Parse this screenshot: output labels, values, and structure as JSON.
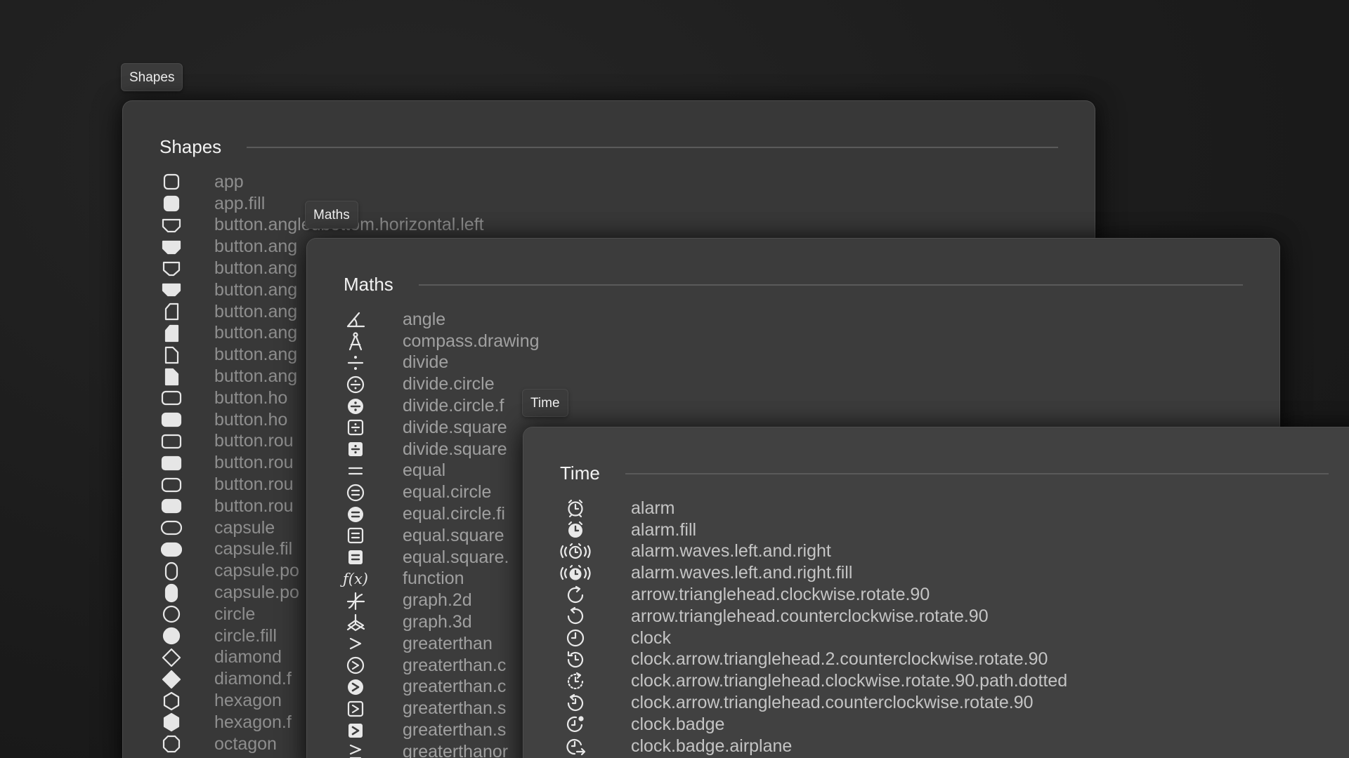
{
  "shapes": {
    "tab_label": "Shapes",
    "title": "Shapes",
    "items": [
      {
        "icon": "app",
        "label": "app"
      },
      {
        "icon": "app-fill",
        "label": "app.fill"
      },
      {
        "icon": "button-angledbottom-horizontal-left",
        "label": "button.angledbottom.horizontal.left"
      },
      {
        "icon": "button-angledbottom-horizontal-left-fill",
        "label": "button.ang"
      },
      {
        "icon": "button-angled-b",
        "label": "button.ang"
      },
      {
        "icon": "button-angled-b-fill",
        "label": "button.ang"
      },
      {
        "icon": "button-angled-v",
        "label": "button.ang"
      },
      {
        "icon": "button-angled-v-fill",
        "label": "button.ang"
      },
      {
        "icon": "button-angled-v2",
        "label": "button.ang"
      },
      {
        "icon": "button-angled-v2-fill",
        "label": "button.ang"
      },
      {
        "icon": "button-horizontal",
        "label": "button.ho"
      },
      {
        "icon": "button-horizontal-fill",
        "label": "button.ho"
      },
      {
        "icon": "button-rounded",
        "label": "button.rou"
      },
      {
        "icon": "button-rounded-fill",
        "label": "button.rou"
      },
      {
        "icon": "button-rounded-2",
        "label": "button.rou"
      },
      {
        "icon": "button-rounded-2-fill",
        "label": "button.rou"
      },
      {
        "icon": "capsule",
        "label": "capsule"
      },
      {
        "icon": "capsule-fill",
        "label": "capsule.fil"
      },
      {
        "icon": "capsule-portrait",
        "label": "capsule.po"
      },
      {
        "icon": "capsule-portrait-fill",
        "label": "capsule.po"
      },
      {
        "icon": "circle",
        "label": "circle"
      },
      {
        "icon": "circle-fill",
        "label": "circle.fill"
      },
      {
        "icon": "diamond",
        "label": "diamond"
      },
      {
        "icon": "diamond-fill",
        "label": "diamond.f"
      },
      {
        "icon": "hexagon",
        "label": "hexagon"
      },
      {
        "icon": "hexagon-fill",
        "label": "hexagon.f"
      },
      {
        "icon": "octagon",
        "label": "octagon"
      }
    ]
  },
  "maths": {
    "tab_label": "Maths",
    "title": "Maths",
    "items": [
      {
        "icon": "angle",
        "label": "angle"
      },
      {
        "icon": "compass-drawing",
        "label": "compass.drawing"
      },
      {
        "icon": "divide",
        "label": "divide"
      },
      {
        "icon": "divide-circle",
        "label": "divide.circle"
      },
      {
        "icon": "divide-circle-fill",
        "label": "divide.circle.f"
      },
      {
        "icon": "divide-square",
        "label": "divide.square"
      },
      {
        "icon": "divide-square-fill",
        "label": "divide.square"
      },
      {
        "icon": "equal",
        "label": "equal"
      },
      {
        "icon": "equal-circle",
        "label": "equal.circle"
      },
      {
        "icon": "equal-circle-fill",
        "label": "equal.circle.fi"
      },
      {
        "icon": "equal-square",
        "label": "equal.square"
      },
      {
        "icon": "equal-square-fill",
        "label": "equal.square."
      },
      {
        "icon": "function",
        "label": "function"
      },
      {
        "icon": "graph-2d",
        "label": "graph.2d"
      },
      {
        "icon": "graph-3d",
        "label": "graph.3d"
      },
      {
        "icon": "greaterthan",
        "label": "greaterthan"
      },
      {
        "icon": "greaterthan-circle",
        "label": "greaterthan.c"
      },
      {
        "icon": "greaterthan-circle-fill",
        "label": "greaterthan.c"
      },
      {
        "icon": "greaterthan-square",
        "label": "greaterthan.s"
      },
      {
        "icon": "greaterthan-square-fill",
        "label": "greaterthan.s"
      },
      {
        "icon": "greaterthanorequal",
        "label": "greaterthanor"
      }
    ]
  },
  "time": {
    "tab_label": "Time",
    "title": "Time",
    "items": [
      {
        "icon": "alarm",
        "label": "alarm"
      },
      {
        "icon": "alarm-fill",
        "label": "alarm.fill"
      },
      {
        "icon": "alarm-waves",
        "label": "alarm.waves.left.and.right"
      },
      {
        "icon": "alarm-waves-fill",
        "label": "alarm.waves.left.and.right.fill"
      },
      {
        "icon": "arrow-cw",
        "label": "arrow.trianglehead.clockwise.rotate.90"
      },
      {
        "icon": "arrow-ccw",
        "label": "arrow.trianglehead.counterclockwise.rotate.90"
      },
      {
        "icon": "clock",
        "label": "clock"
      },
      {
        "icon": "clock-arrow-2-ccw",
        "label": "clock.arrow.trianglehead.2.counterclockwise.rotate.90"
      },
      {
        "icon": "clock-arrow-cw-dotted",
        "label": "clock.arrow.trianglehead.clockwise.rotate.90.path.dotted"
      },
      {
        "icon": "clock-arrow-ccw",
        "label": "clock.arrow.trianglehead.counterclockwise.rotate.90"
      },
      {
        "icon": "clock-badge",
        "label": "clock.badge"
      },
      {
        "icon": "clock-badge-airplane",
        "label": "clock.badge.airplane"
      }
    ]
  }
}
